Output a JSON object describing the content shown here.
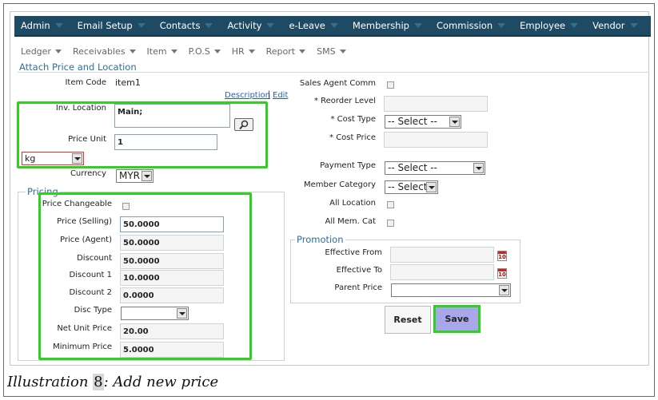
{
  "top_menu": [
    {
      "label": "Admin"
    },
    {
      "label": "Email Setup"
    },
    {
      "label": "Contacts"
    },
    {
      "label": "Activity"
    },
    {
      "label": "e-Leave"
    },
    {
      "label": "Membership"
    },
    {
      "label": "Commission"
    },
    {
      "label": "Employee"
    },
    {
      "label": "Vendor"
    }
  ],
  "sub_menu": [
    {
      "label": "Ledger"
    },
    {
      "label": "Receivables"
    },
    {
      "label": "Item"
    },
    {
      "label": "P.O.S"
    },
    {
      "label": "HR"
    },
    {
      "label": "Report"
    },
    {
      "label": "SMS"
    }
  ],
  "section_title": "Attach Price and Location",
  "left": {
    "item_code_label": "Item Code",
    "item_code_value": "item1",
    "description_link": "Description",
    "link_separator": "|",
    "edit_link": "Edit",
    "inv_location_label": "Inv. Location",
    "inv_location_value": "Main;",
    "price_unit_label": "Price Unit",
    "price_unit_value": "1",
    "unit_select_value": "kg",
    "currency_label": "Currency",
    "currency_value": "MYR"
  },
  "pricing": {
    "legend": "Pricing",
    "price_changeable_label": "Price Changeable",
    "price_selling_label": "Price (Selling)",
    "price_selling_value": "50.0000",
    "price_agent_label": "Price (Agent)",
    "price_agent_value": "50.0000",
    "discount_label": "Discount",
    "discount_value": "50.0000",
    "discount1_label": "Discount 1",
    "discount1_value": "10.0000",
    "discount2_label": "Discount 2",
    "discount2_value": "0.0000",
    "disc_type_label": "Disc Type",
    "disc_type_value": "",
    "net_unit_price_label": "Net Unit Price",
    "net_unit_price_value": "20.00",
    "minimum_price_label": "Minimum Price",
    "minimum_price_value": "5.0000"
  },
  "right": {
    "sales_agent_comm_label": "Sales Agent Comm",
    "reorder_level_label": "* Reorder Level",
    "cost_type_label": "* Cost Type",
    "cost_type_value": "-- Select --",
    "cost_price_label": "* Cost Price",
    "payment_type_label": "Payment Type",
    "payment_type_value": "-- Select --",
    "member_category_label": "Member Category",
    "member_category_value": "-- Select",
    "all_location_label": "All Location",
    "all_mem_cat_label": "All Mem. Cat"
  },
  "promotion": {
    "legend": "Promotion",
    "effective_from_label": "Effective From",
    "effective_to_label": "Effective To",
    "parent_price_label": "Parent Price",
    "calendar_text": "10"
  },
  "buttons": {
    "reset": "Reset",
    "save": "Save"
  },
  "caption": {
    "prefix": "Illustration ",
    "number": "8",
    "suffix": ": Add new price"
  },
  "colors": {
    "nav_bg": "#1f4a63",
    "highlight": "#2ed11f",
    "save_bg": "#a7a7ea",
    "legend_text": "#2e6e9e"
  }
}
